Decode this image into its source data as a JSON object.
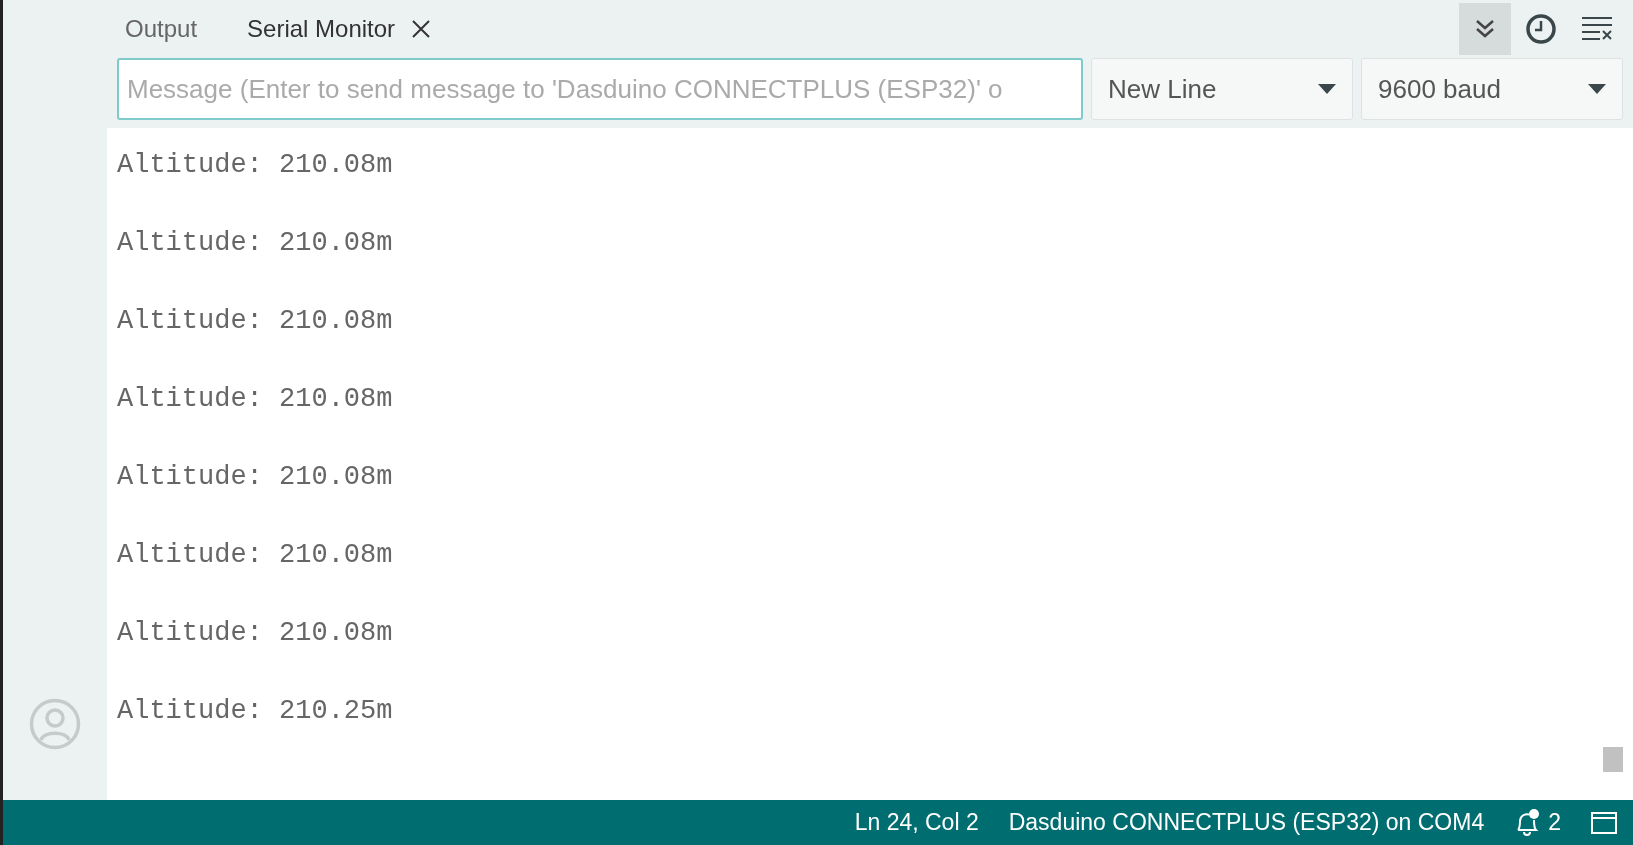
{
  "tabs": [
    {
      "label": "Output",
      "selected": false,
      "closable": false
    },
    {
      "label": "Serial Monitor",
      "selected": true,
      "closable": true
    }
  ],
  "toolbar": [
    {
      "kind": "autoscroll",
      "selected": true
    },
    {
      "kind": "timestamp",
      "selected": false
    },
    {
      "kind": "clear",
      "selected": false
    }
  ],
  "message": {
    "placeholder": "Message (Enter to send message to 'Dasduino CONNECTPLUS (ESP32)' o"
  },
  "line_ending": {
    "value": "New Line"
  },
  "baud_rate": {
    "value": "9600 baud"
  },
  "output_lines": [
    "Altitude: 210.08m",
    "Altitude: 210.08m",
    "Altitude: 210.08m",
    "Altitude: 210.08m",
    "Altitude: 210.08m",
    "Altitude: 210.08m",
    "Altitude: 210.08m",
    "Altitude: 210.25m"
  ],
  "status_bar": {
    "position": "Ln 24, Col 2",
    "board": "Dasduino CONNECTPLUS (ESP32) on COM4",
    "notifications": "2",
    "notification_dot": true
  }
}
